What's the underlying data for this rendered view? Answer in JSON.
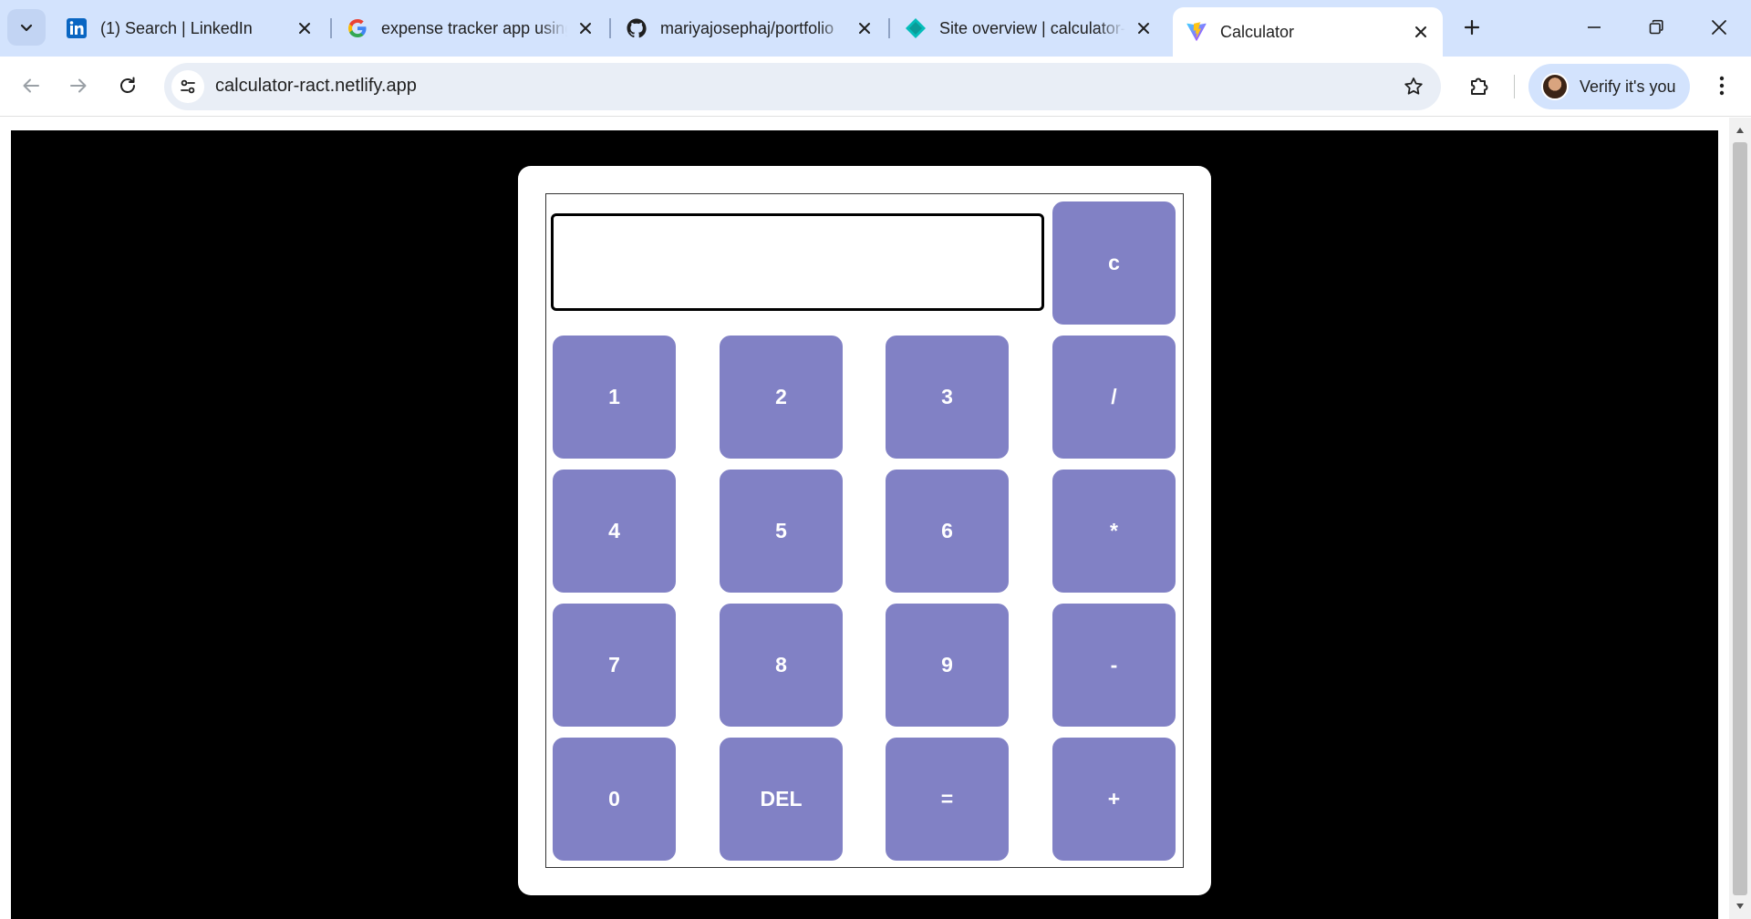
{
  "browser": {
    "tabs": [
      {
        "title": "(1) Search | LinkedIn",
        "icon": "linkedin-icon",
        "active": false
      },
      {
        "title": "expense tracker app using react",
        "icon": "google-icon",
        "active": false
      },
      {
        "title": "mariyajosephaj/portfolio",
        "icon": "github-icon",
        "active": false
      },
      {
        "title": "Site overview | calculator-ract",
        "icon": "netlify-icon",
        "active": false
      },
      {
        "title": "Calculator",
        "icon": "vite-icon",
        "active": true
      }
    ],
    "address": "calculator-ract.netlify.app",
    "profile_label": "Verify it's you"
  },
  "calculator": {
    "display_value": "",
    "clear_label": "c",
    "keys": [
      "1",
      "2",
      "3",
      "/",
      "4",
      "5",
      "6",
      "*",
      "7",
      "8",
      "9",
      "-",
      "0",
      "DEL",
      "=",
      "+"
    ]
  },
  "colors": {
    "tabstrip": "#d3e3fd",
    "page_background": "#000000",
    "key_background": "#8181c5",
    "key_text": "#ffffff"
  }
}
